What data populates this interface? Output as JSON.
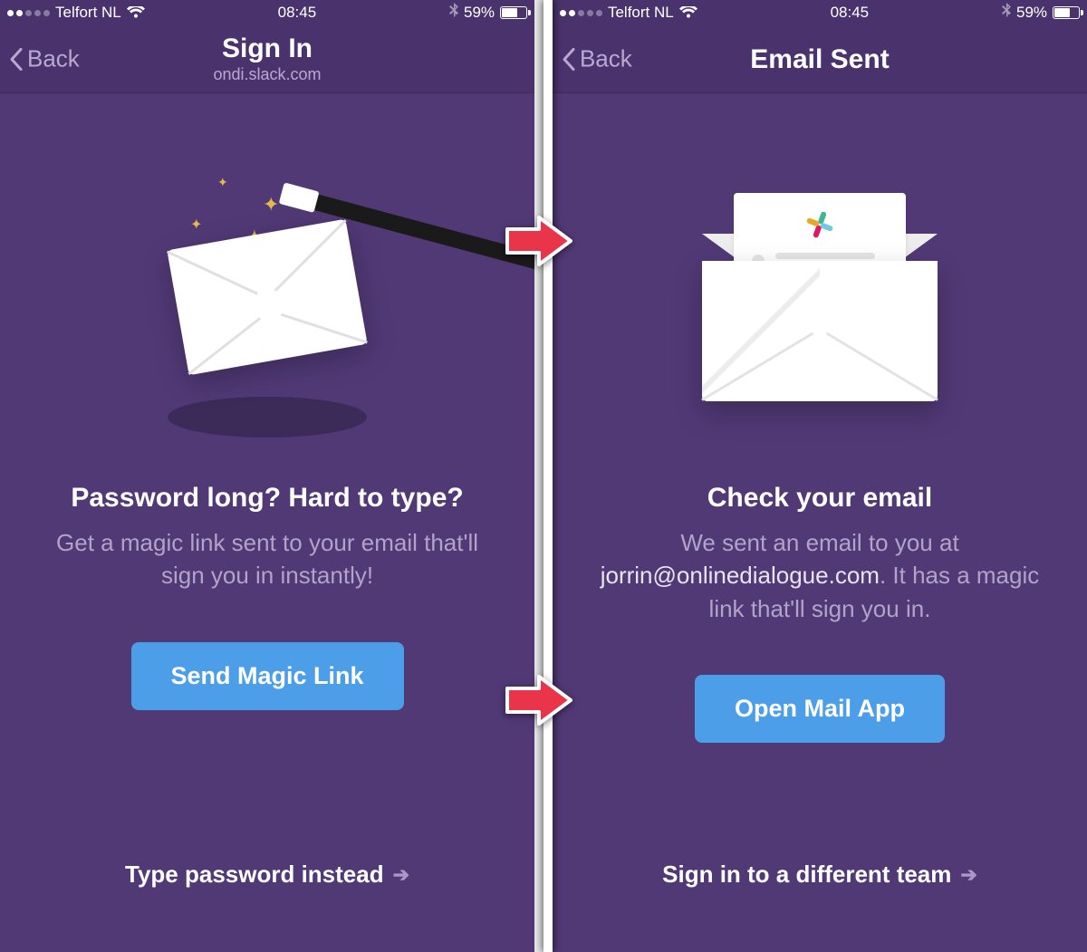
{
  "status": {
    "carrier": "Telfort NL",
    "time": "08:45",
    "battery_pct": "59%"
  },
  "left": {
    "nav": {
      "back": "Back",
      "title": "Sign In",
      "subtitle": "ondi.slack.com"
    },
    "heading": "Password long? Hard to type?",
    "sub": "Get a magic link sent to your email that'll sign you in instantly!",
    "cta": "Send Magic Link",
    "footer": "Type password instead"
  },
  "right": {
    "nav": {
      "back": "Back",
      "title": "Email Sent"
    },
    "heading": "Check your email",
    "sub_pre": "We sent an email to you at ",
    "email": "jorrin@onlinedialogue.com",
    "sub_post": ". It has a magic link that'll sign you in.",
    "cta": "Open Mail App",
    "footer": "Sign in to a different team"
  }
}
